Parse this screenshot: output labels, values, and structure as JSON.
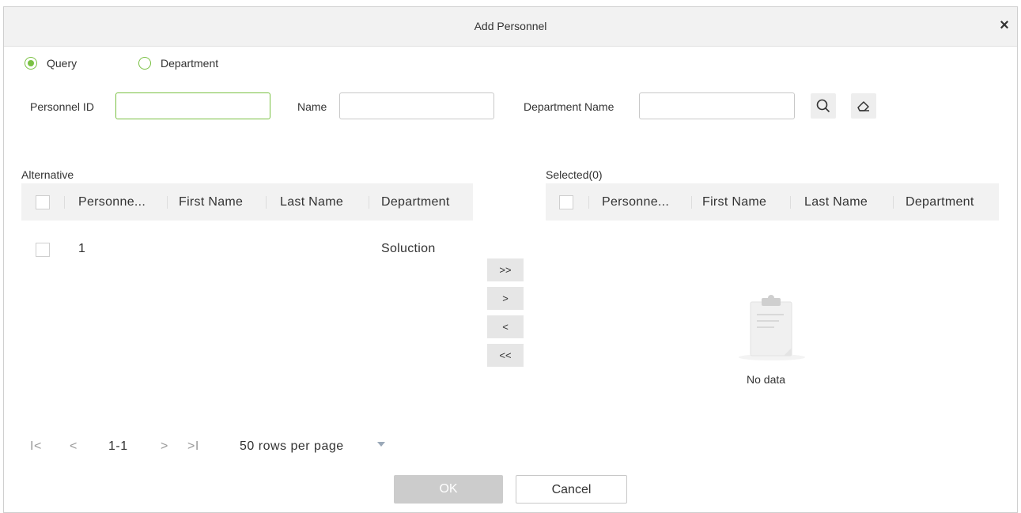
{
  "dialog": {
    "title": "Add Personnel",
    "close_symbol": "×"
  },
  "mode": {
    "query_label": "Query",
    "department_label": "Department",
    "selected": "Query"
  },
  "filters": {
    "personnel_id_label": "Personnel ID",
    "personnel_id_value": "",
    "name_label": "Name",
    "name_value": "",
    "department_name_label": "Department Name",
    "department_name_value": "",
    "search_icon": "search-icon",
    "clear_icon": "eraser-icon"
  },
  "alternative": {
    "title": "Alternative",
    "columns": [
      "Personne...",
      "First Name",
      "Last Name",
      "Department"
    ],
    "rows": [
      {
        "personnel_id": "1",
        "first_name": "",
        "last_name": "",
        "department": "Soluction"
      }
    ]
  },
  "transfer": {
    "move_all_right": ">>",
    "move_right": ">",
    "move_left": "<",
    "move_all_left": "<<"
  },
  "selected": {
    "title": "Selected(0)",
    "columns": [
      "Personne...",
      "First Name",
      "Last Name",
      "Department"
    ],
    "empty_text": "No data"
  },
  "pagination": {
    "first": "I<",
    "prev": "<",
    "range": "1-1",
    "next": ">",
    "last": ">I",
    "rows_per_page": "50 rows per page"
  },
  "footer": {
    "ok_label": "OK",
    "cancel_label": "Cancel"
  },
  "colors": {
    "accent": "#7ac143",
    "header_bg": "#f2f2f2",
    "disabled_button": "#cccccc"
  }
}
